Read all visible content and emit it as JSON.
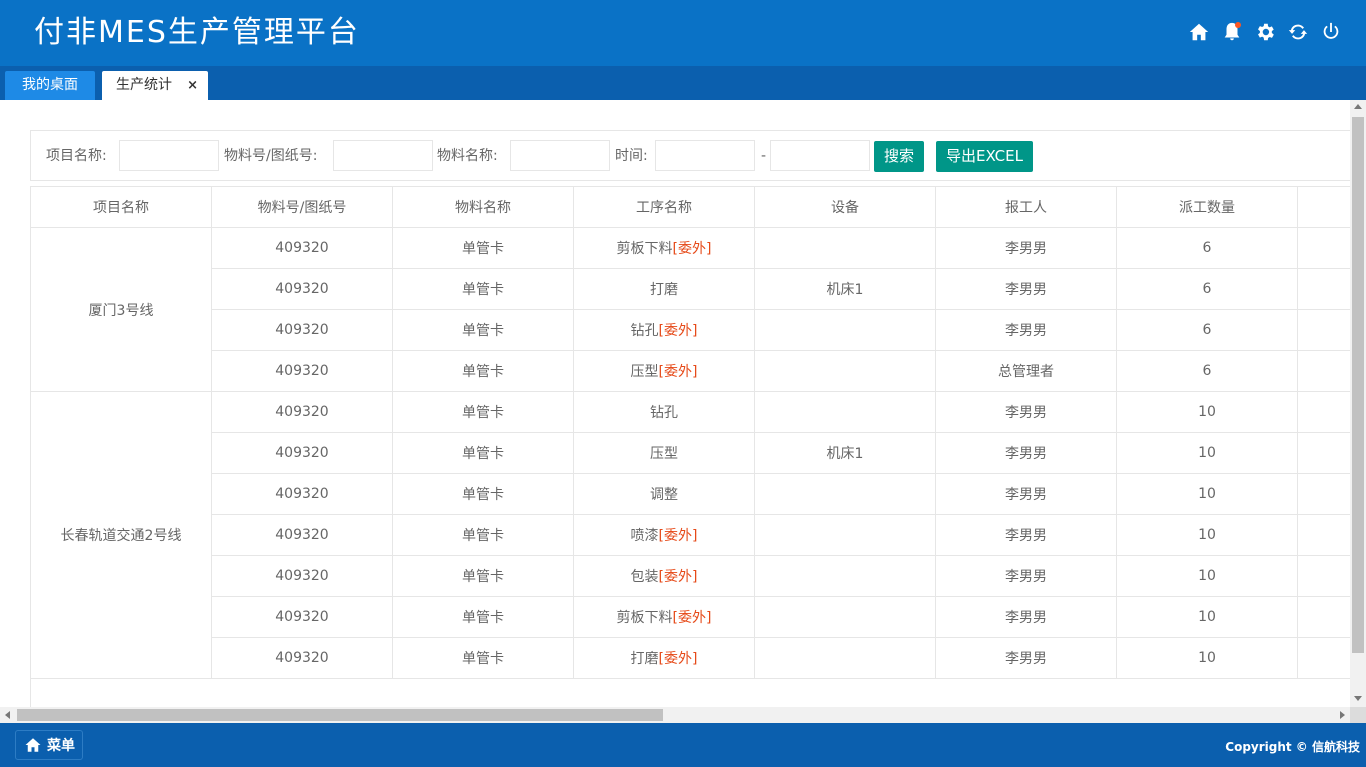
{
  "app": {
    "title": "付非MES生产管理平台"
  },
  "header": {
    "icons": [
      "home-icon",
      "bell-icon",
      "gear-icon",
      "refresh-icon",
      "power-icon"
    ],
    "bell_badge_color": "#ff5722"
  },
  "tabs": [
    {
      "label": "我的桌面"
    },
    {
      "label": "生产统计",
      "close": "×"
    }
  ],
  "filter": {
    "project_label": "项目名称:",
    "part_label": "物料号/图纸号:",
    "material_label": "物料名称:",
    "time_label": "时间:",
    "time_sep": "-",
    "search_button": "搜索",
    "export_button": "导出EXCEL"
  },
  "table": {
    "headers": [
      "项目名称",
      "物料号/图纸号",
      "物料名称",
      "工序名称",
      "设备",
      "报工人",
      "派工数量"
    ],
    "groups": [
      {
        "project": "厦门3号线",
        "rows": [
          {
            "part": "409320",
            "material": "单管卡",
            "process": "剪板下料",
            "outsourced": "[委外]",
            "device": "",
            "reporter": "李男男",
            "qty": "6"
          },
          {
            "part": "409320",
            "material": "单管卡",
            "process": "打磨",
            "outsourced": "",
            "device": "机床1",
            "reporter": "李男男",
            "qty": "6"
          },
          {
            "part": "409320",
            "material": "单管卡",
            "process": "钻孔",
            "outsourced": "[委外]",
            "device": "",
            "reporter": "李男男",
            "qty": "6"
          },
          {
            "part": "409320",
            "material": "单管卡",
            "process": "压型",
            "outsourced": "[委外]",
            "device": "",
            "reporter": "总管理者",
            "qty": "6"
          }
        ]
      },
      {
        "project": "长春轨道交通2号线",
        "rows": [
          {
            "part": "409320",
            "material": "单管卡",
            "process": "钻孔",
            "outsourced": "",
            "device": "",
            "reporter": "李男男",
            "qty": "10"
          },
          {
            "part": "409320",
            "material": "单管卡",
            "process": "压型",
            "outsourced": "",
            "device": "机床1",
            "reporter": "李男男",
            "qty": "10"
          },
          {
            "part": "409320",
            "material": "单管卡",
            "process": "调整",
            "outsourced": "",
            "device": "",
            "reporter": "李男男",
            "qty": "10"
          },
          {
            "part": "409320",
            "material": "单管卡",
            "process": "喷漆",
            "outsourced": "[委外]",
            "device": "",
            "reporter": "李男男",
            "qty": "10"
          },
          {
            "part": "409320",
            "material": "单管卡",
            "process": "包装",
            "outsourced": "[委外]",
            "device": "",
            "reporter": "李男男",
            "qty": "10"
          },
          {
            "part": "409320",
            "material": "单管卡",
            "process": "剪板下料",
            "outsourced": "[委外]",
            "device": "",
            "reporter": "李男男",
            "qty": "10"
          },
          {
            "part": "409320",
            "material": "单管卡",
            "process": "打磨",
            "outsourced": "[委外]",
            "device": "",
            "reporter": "李男男",
            "qty": "10"
          }
        ]
      }
    ]
  },
  "footer": {
    "menu_label": "菜单",
    "copyright": "Copyright © 信航科技"
  },
  "colors": {
    "header_bg": "#0a72c6",
    "tabbar_bg": "#0b5fae",
    "button_bg": "#009688",
    "outsourced": "#e64a19"
  }
}
